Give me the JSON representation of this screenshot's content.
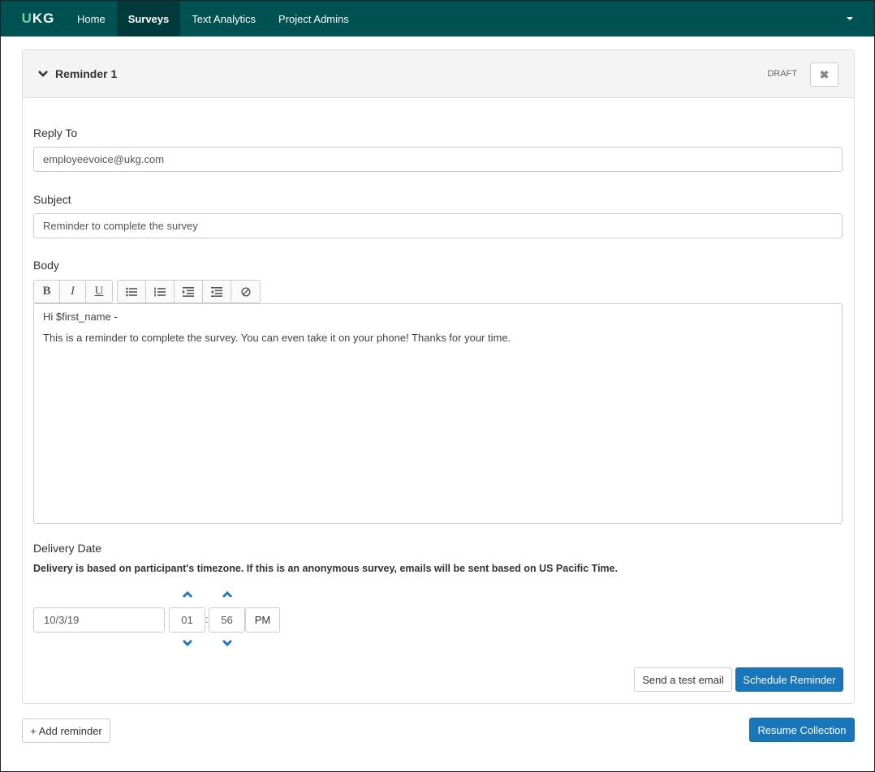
{
  "nav": {
    "logo": "UKG",
    "items": [
      {
        "label": "Home",
        "active": false
      },
      {
        "label": "Surveys",
        "active": true
      },
      {
        "label": "Text Analytics",
        "active": false
      },
      {
        "label": "Project Admins",
        "active": false
      }
    ]
  },
  "reminder": {
    "title": "Reminder 1",
    "status": "DRAFT",
    "close_icon": "✖",
    "reply_to": {
      "label": "Reply To",
      "value": "employeevoice@ukg.com"
    },
    "subject": {
      "label": "Subject",
      "value": "Reminder to complete the survey"
    },
    "body": {
      "label": "Body",
      "toolbar": {
        "bold": "B",
        "italic": "I",
        "underline": "U"
      },
      "lines": [
        "Hi $first_name -",
        "This is a reminder to complete the survey. You can even take it on your phone! Thanks for your time."
      ]
    },
    "delivery": {
      "label": "Delivery Date",
      "note": "Delivery is based on participant's timezone. If this is an anonymous survey, emails will be sent based on US Pacific Time.",
      "date": "10/3/19",
      "hour": "01",
      "separator": ":",
      "minute": "56",
      "meridiem": "PM"
    },
    "send_test_label": "Send a test email",
    "schedule_label": "Schedule Reminder"
  },
  "footer": {
    "add_reminder_label": "+ Add reminder",
    "resume_label": "Resume Collection"
  }
}
